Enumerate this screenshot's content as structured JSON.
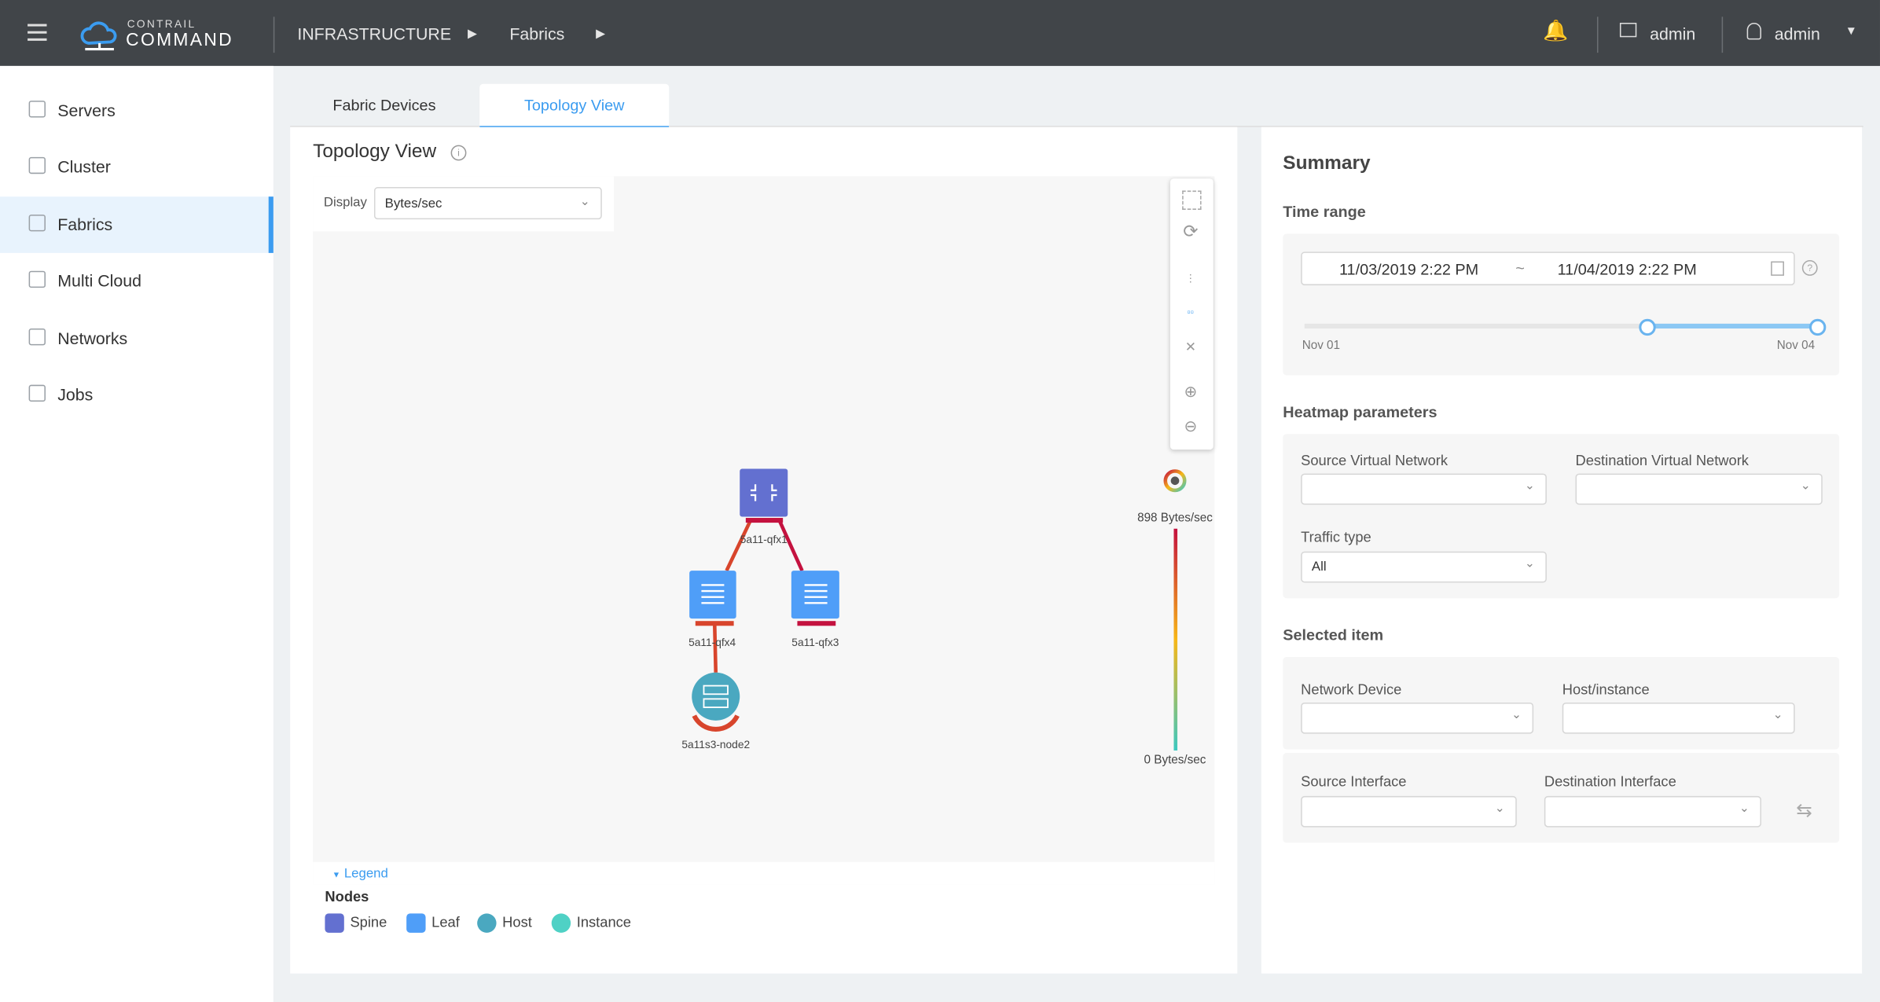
{
  "header": {
    "brand_top": "CONTRAIL",
    "brand_bottom": "COMMAND",
    "breadcrumb": [
      "INFRASTRUCTURE",
      "Fabrics"
    ],
    "project_label": "admin",
    "user_label": "admin"
  },
  "sidebar": {
    "items": [
      {
        "label": "Servers",
        "icon": "servers-icon"
      },
      {
        "label": "Cluster",
        "icon": "cluster-icon"
      },
      {
        "label": "Fabrics",
        "icon": "fabrics-icon",
        "active": true
      },
      {
        "label": "Multi Cloud",
        "icon": "multicloud-icon"
      },
      {
        "label": "Networks",
        "icon": "networks-icon"
      },
      {
        "label": "Jobs",
        "icon": "jobs-icon"
      }
    ]
  },
  "tabs": [
    {
      "label": "Fabric Devices"
    },
    {
      "label": "Topology View",
      "active": true
    }
  ],
  "topology": {
    "title": "Topology View",
    "display_label": "Display",
    "display_value": "Bytes/sec",
    "nodes": [
      {
        "name": "5a11-qfx1",
        "type": "Spine"
      },
      {
        "name": "5a11-qfx4",
        "type": "Leaf"
      },
      {
        "name": "5a11-qfx3",
        "type": "Leaf"
      },
      {
        "name": "5a11s3-node2",
        "type": "Host"
      }
    ],
    "scale_max": "898 Bytes/sec",
    "scale_min": "0 Bytes/sec",
    "legend_toggle": "Legend",
    "legend_title": "Nodes",
    "legend": [
      {
        "label": "Spine",
        "color": "#6370d0"
      },
      {
        "label": "Leaf",
        "color": "#4f9ef8"
      },
      {
        "label": "Host",
        "color": "#4aa8c0"
      },
      {
        "label": "Instance",
        "color": "#4fd1c5"
      }
    ]
  },
  "summary": {
    "title": "Summary",
    "time_range_label": "Time range",
    "start": "11/03/2019 2:22 PM",
    "separator": "~",
    "end": "11/04/2019 2:22 PM",
    "slider_start_label": "Nov 01",
    "slider_end_label": "Nov 04",
    "heatmap_label": "Heatmap parameters",
    "src_vn_label": "Source Virtual Network",
    "dst_vn_label": "Destination Virtual Network",
    "traffic_type_label": "Traffic type",
    "traffic_type_value": "All",
    "selected_label": "Selected item",
    "network_device_label": "Network Device",
    "host_instance_label": "Host/instance",
    "src_if_label": "Source Interface",
    "dst_if_label": "Destination Interface"
  },
  "colors": {
    "accent": "#3b9cf0",
    "header": "#414549"
  }
}
